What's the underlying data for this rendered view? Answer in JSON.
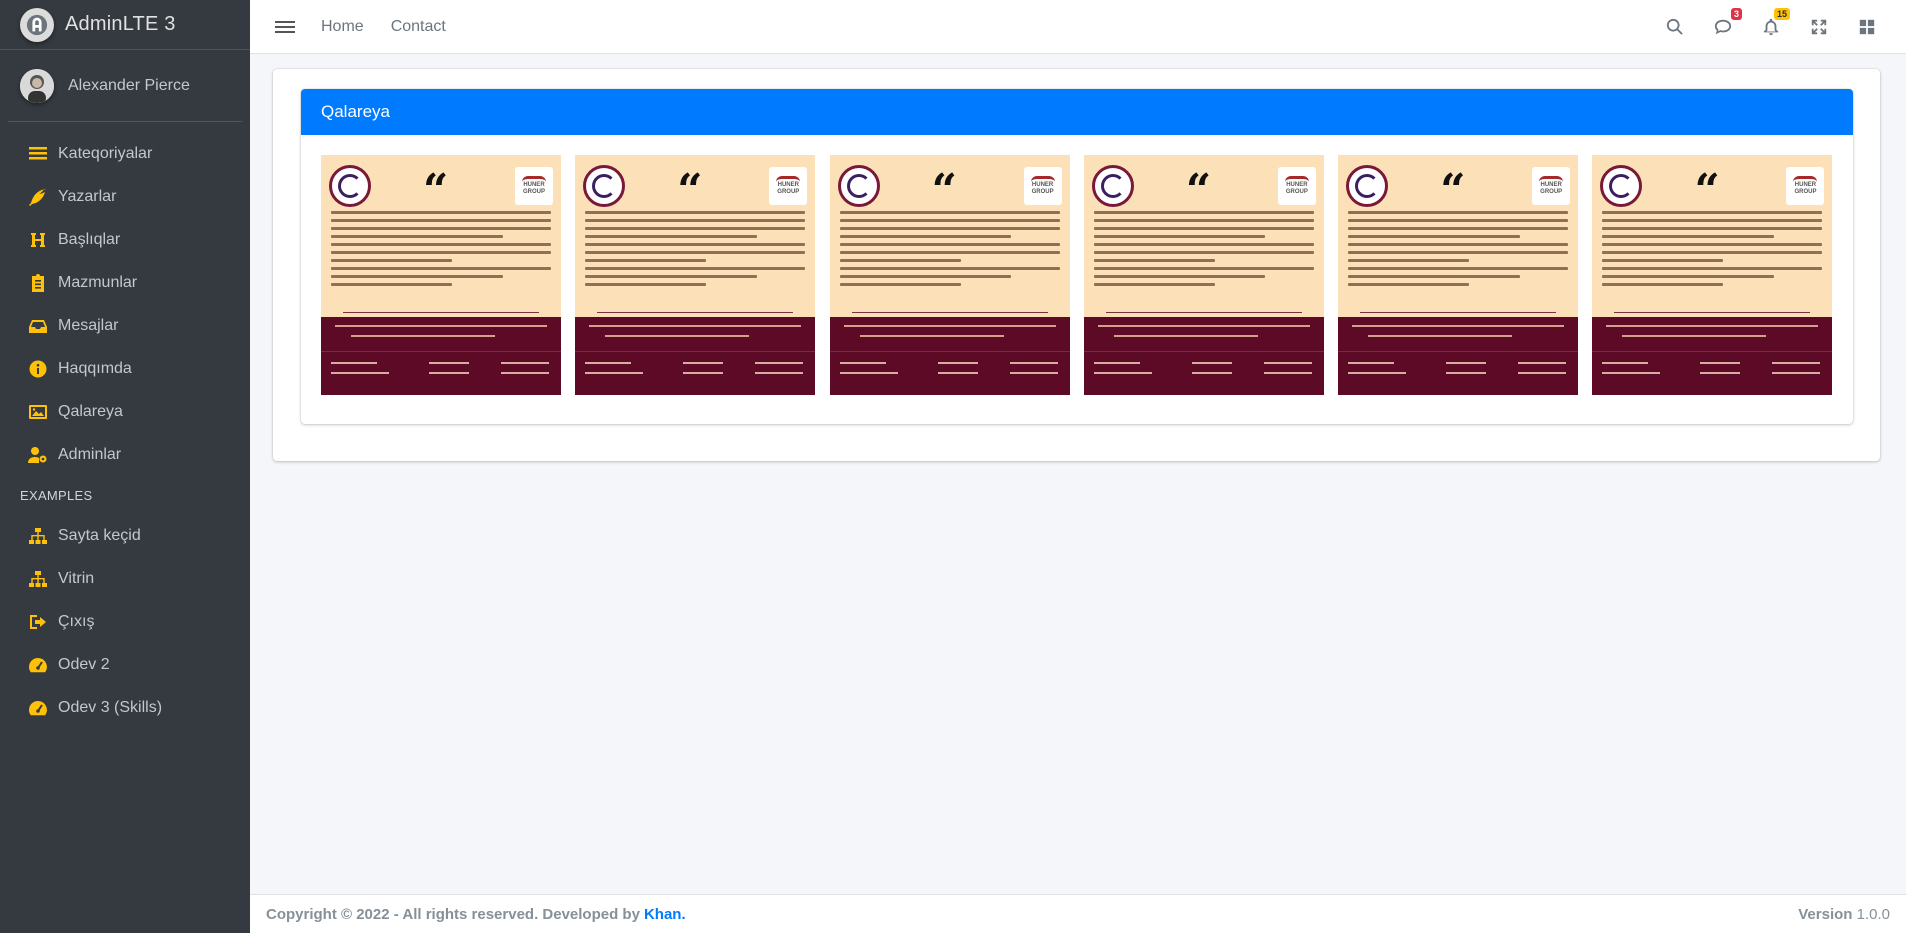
{
  "brand": {
    "name": "AdminLTE 3"
  },
  "user": {
    "name": "Alexander Pierce"
  },
  "sidebar": {
    "items": [
      {
        "label": "Kateqoriyalar",
        "icon": "list-icon"
      },
      {
        "label": "Yazarlar",
        "icon": "feather-icon"
      },
      {
        "label": "Başlıqlar",
        "icon": "heading-icon"
      },
      {
        "label": "Mazmunlar",
        "icon": "clipboard-icon"
      },
      {
        "label": "Mesajlar",
        "icon": "inbox-icon"
      },
      {
        "label": "Haqqımda",
        "icon": "info-icon"
      },
      {
        "label": "Qalareya",
        "icon": "images-icon"
      },
      {
        "label": "Adminlar",
        "icon": "user-cog-icon"
      }
    ],
    "section_header": "EXAMPLES",
    "example_items": [
      {
        "label": "Sayta keçid",
        "icon": "sitemap-icon"
      },
      {
        "label": "Vitrin",
        "icon": "sitemap-icon"
      },
      {
        "label": "Çıxış",
        "icon": "sign-out-icon"
      },
      {
        "label": "Odev 2",
        "icon": "tachometer-icon"
      },
      {
        "label": "Odev 3 (Skills)",
        "icon": "tachometer-icon"
      }
    ]
  },
  "navbar": {
    "links": [
      "Home",
      "Contact"
    ],
    "messages_badge": "3",
    "notifications_badge": "15"
  },
  "gallery": {
    "title": "Qalareya",
    "images": [
      {
        "alt": "gallery-image-1"
      },
      {
        "alt": "gallery-image-2"
      },
      {
        "alt": "gallery-image-3"
      },
      {
        "alt": "gallery-image-4"
      },
      {
        "alt": "gallery-image-5"
      },
      {
        "alt": "gallery-image-6"
      }
    ]
  },
  "footer": {
    "copyright": "Copyright © 2022 - All rights reserved. Developed by",
    "author": "Khan.",
    "version_label": "Version",
    "version": "1.0.0"
  },
  "colors": {
    "primary": "#007bff",
    "sidebar_bg": "#343a40",
    "icon_accent": "#ffc107",
    "badge_red": "#dc3545",
    "badge_yellow": "#ffc107"
  }
}
